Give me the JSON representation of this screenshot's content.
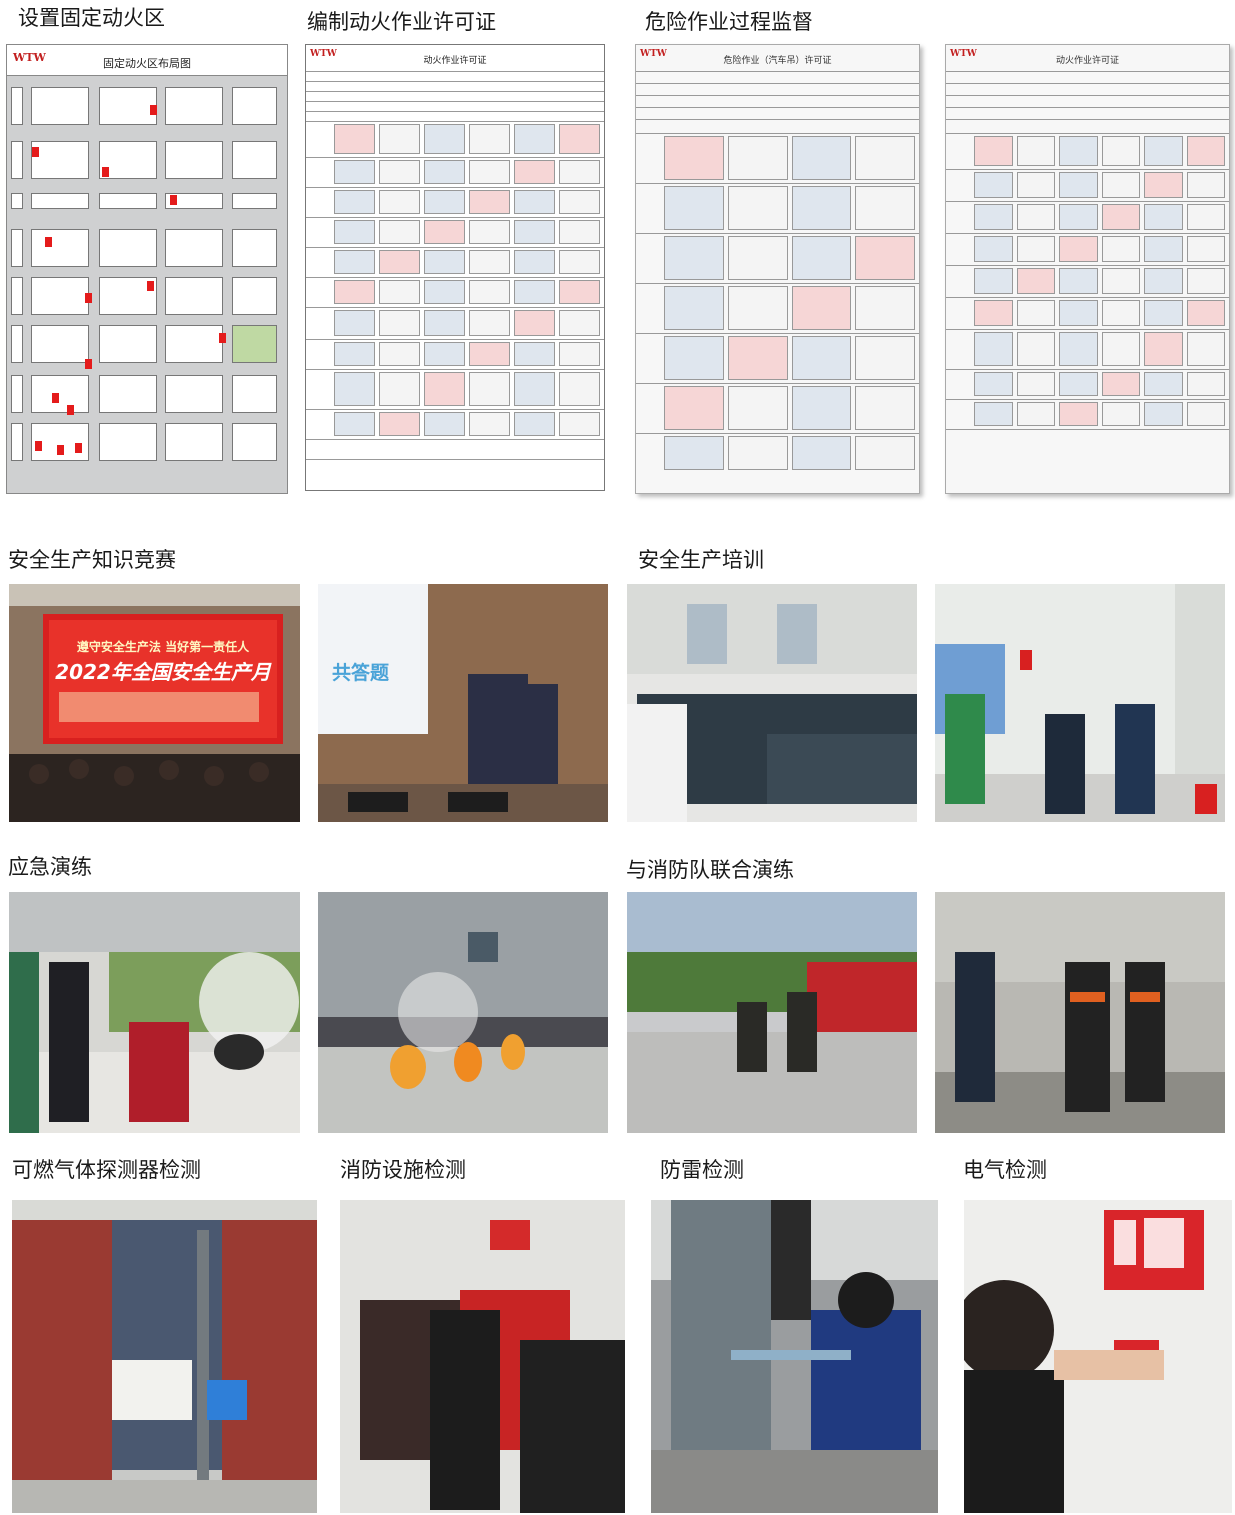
{
  "sections": {
    "fixed_hot_work_area": "设置固定动火区",
    "hot_work_permit": "编制动火作业许可证",
    "dangerous_work_supervision": "危险作业过程监督",
    "safety_knowledge_contest": "安全生产知识竞赛",
    "safety_training": "安全生产培训",
    "emergency_drill": "应急演练",
    "joint_fire_drill": "与消防队联合演练",
    "gas_detector_test": "可燃气体探测器检测",
    "fire_facility_test": "消防设施检测",
    "lightning_test": "防雷检测",
    "electrical_test": "电气检测"
  },
  "floorplan": {
    "logo": "WTW",
    "title": "固定动火区布局图"
  },
  "permit": {
    "logo": "WTW",
    "title": "动火作业许可证"
  },
  "hazard_permit": {
    "logo": "WTW",
    "title": "危险作业（汽车吊）许可证"
  },
  "signed_permit": {
    "logo": "WTW",
    "title": "动火作业许可证"
  },
  "contest_screen": {
    "slogan": "遵守安全生产法 当好第一责任人",
    "headline": "2022年全国安全生产月"
  },
  "contest_slide": {
    "text": "共答题"
  },
  "colors": {
    "accent_red": "#e41b1b",
    "heading_text": "#1a1a1a",
    "floor_bg": "#cfd0d1"
  }
}
